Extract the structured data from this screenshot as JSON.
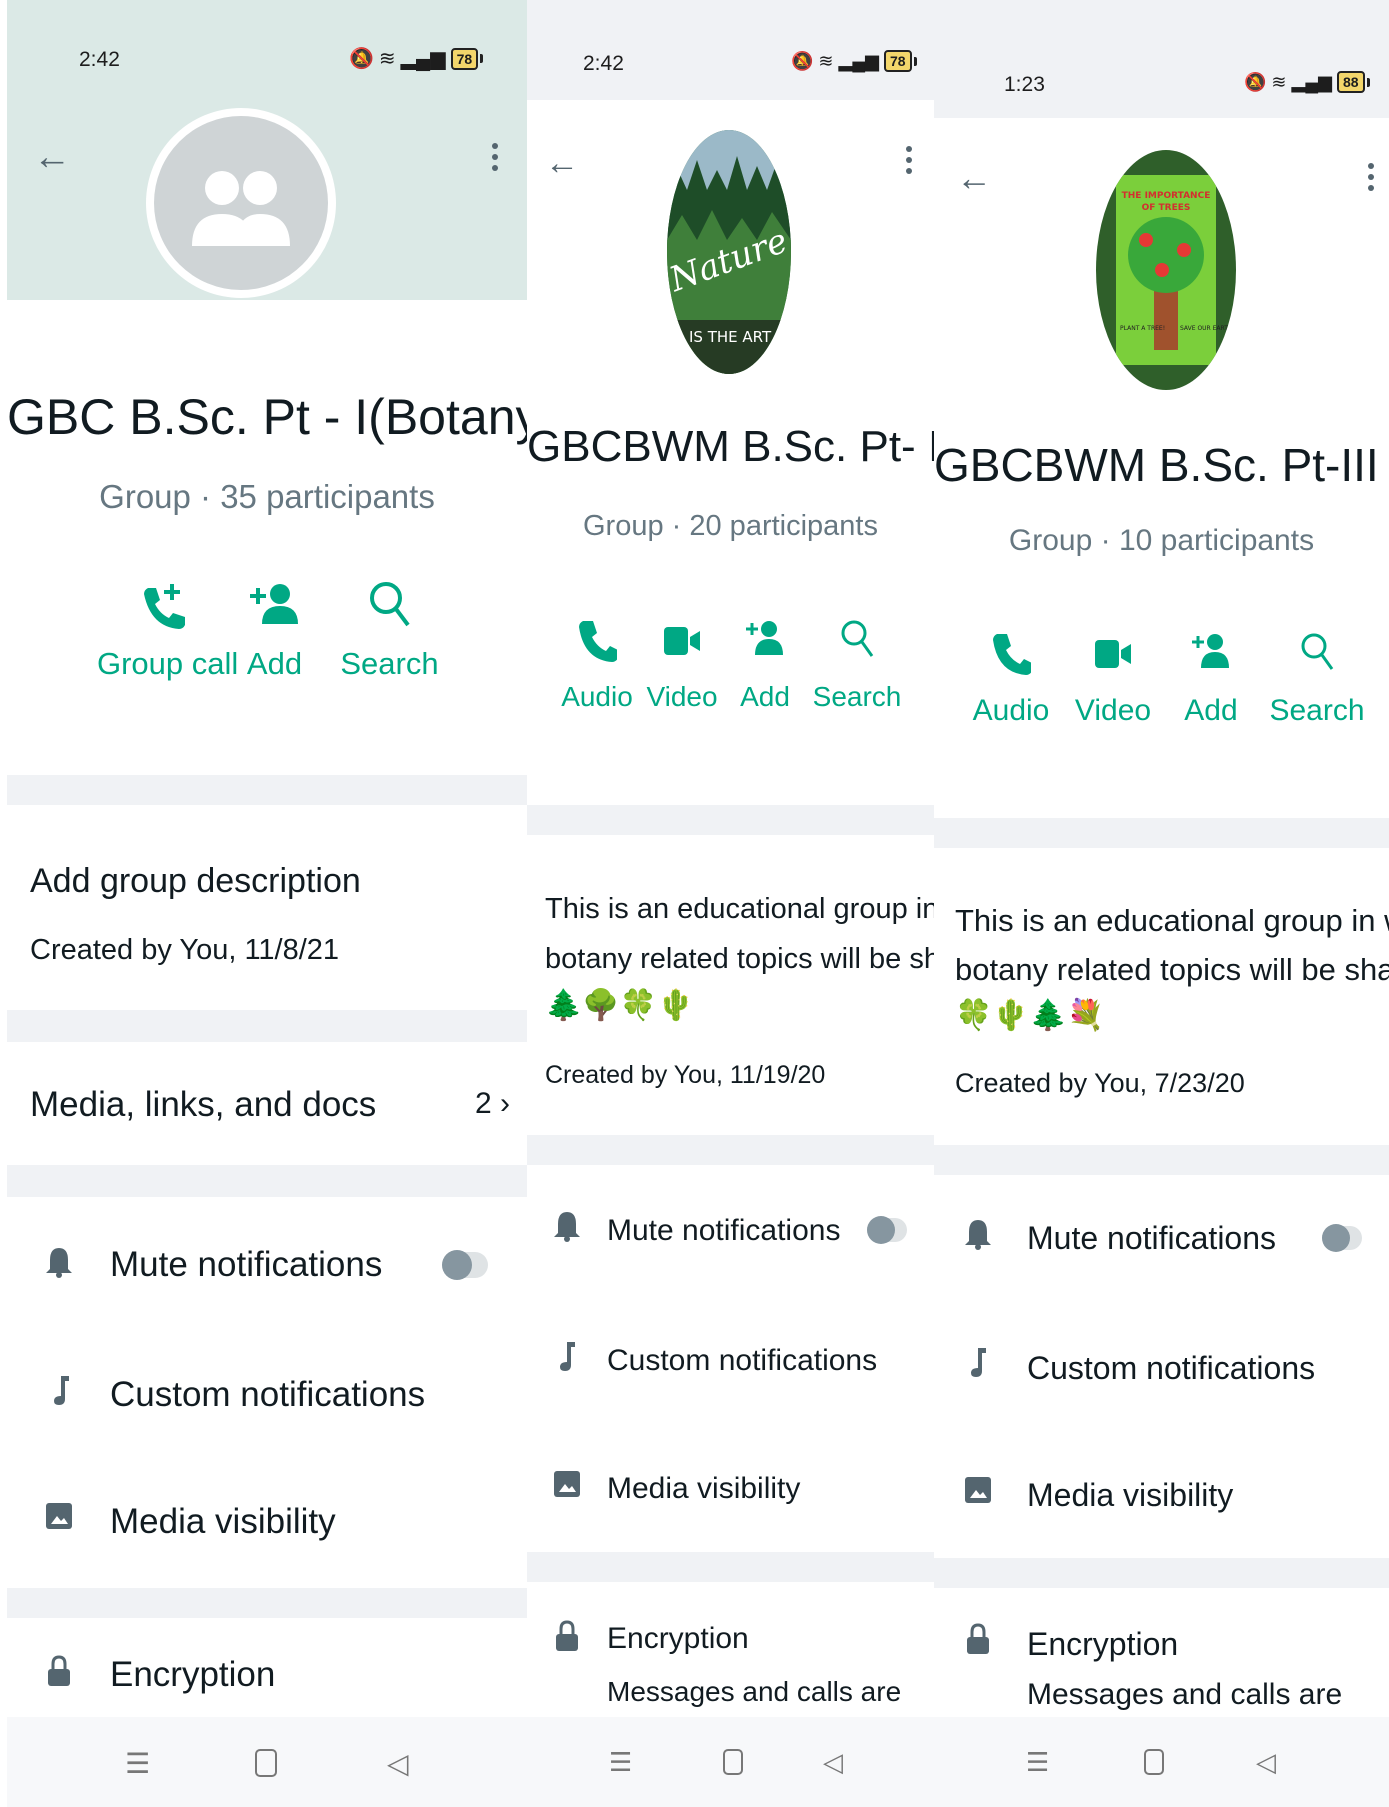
{
  "panels": [
    {
      "status": {
        "time": "2:42",
        "battery": "78"
      },
      "title": "GBC B.Sc. Pt - I(Botany)",
      "subtitle": "Group · 35 participants",
      "actions": [
        {
          "icon": "group-call-icon",
          "label": "Group call"
        },
        {
          "icon": "add-person-icon",
          "label": "Add"
        },
        {
          "icon": "search-icon",
          "label": "Search"
        }
      ],
      "description": {
        "text": "Add group description",
        "created": "Created by You, 11/8/21"
      },
      "media": {
        "label": "Media, links, and docs",
        "count": "2"
      },
      "settings": {
        "mute": "Mute notifications",
        "custom": "Custom notifications",
        "visibility": "Media visibility",
        "encryption": "Encryption"
      }
    },
    {
      "status": {
        "time": "2:42",
        "battery": "78"
      },
      "avatar_text": {
        "line1": "Nature",
        "line2": "IS THE ART OF G"
      },
      "title": "GBCBWM B.Sc. Pt- II Bot",
      "subtitle": "Group · 20 participants",
      "actions": [
        {
          "icon": "phone-icon",
          "label": "Audio"
        },
        {
          "icon": "video-icon",
          "label": "Video"
        },
        {
          "icon": "add-person-icon",
          "label": "Add"
        },
        {
          "icon": "search-icon",
          "label": "Search"
        }
      ],
      "description": {
        "line1": "This is an educational group in which",
        "line2": "botany related topics will be shared.",
        "emoji_line2": "💐",
        "emoji_line3": "🌲🌳🍀🌵",
        "created": "Created by You, 11/19/20"
      },
      "settings": {
        "mute": "Mute notifications",
        "custom": "Custom notifications",
        "visibility": "Media visibility",
        "encryption": "Encryption",
        "encryption_sub": "Messages and calls are"
      }
    },
    {
      "status": {
        "time": "1:23",
        "battery": "88"
      },
      "avatar_text": {
        "line1": "THE IMPORTANCE",
        "line2": "OF TREES",
        "line3": "PLANT A TREE!",
        "line4": "SAVE OUR EARTH"
      },
      "title": "GBCBWM B.Sc. Pt-III Bot",
      "subtitle": "Group · 10 participants",
      "actions": [
        {
          "icon": "phone-icon",
          "label": "Audio"
        },
        {
          "icon": "video-icon",
          "label": "Video"
        },
        {
          "icon": "add-person-icon",
          "label": "Add"
        },
        {
          "icon": "search-icon",
          "label": "Search"
        }
      ],
      "description": {
        "line1": "This is an educational group in which",
        "line2": "botany related topics will be shared.",
        "emoji_line2": "🌳",
        "emoji_line3": "🍀🌵🌲💐",
        "created": "Created by You, 7/23/20"
      },
      "settings": {
        "mute": "Mute notifications",
        "custom": "Custom notifications",
        "visibility": "Media visibility",
        "encryption": "Encryption",
        "encryption_sub": "Messages and calls are"
      }
    }
  ],
  "colors": {
    "accent": "#00a884",
    "header": "#dbe9e6",
    "icon": "#54656f",
    "subtext": "#667781"
  }
}
